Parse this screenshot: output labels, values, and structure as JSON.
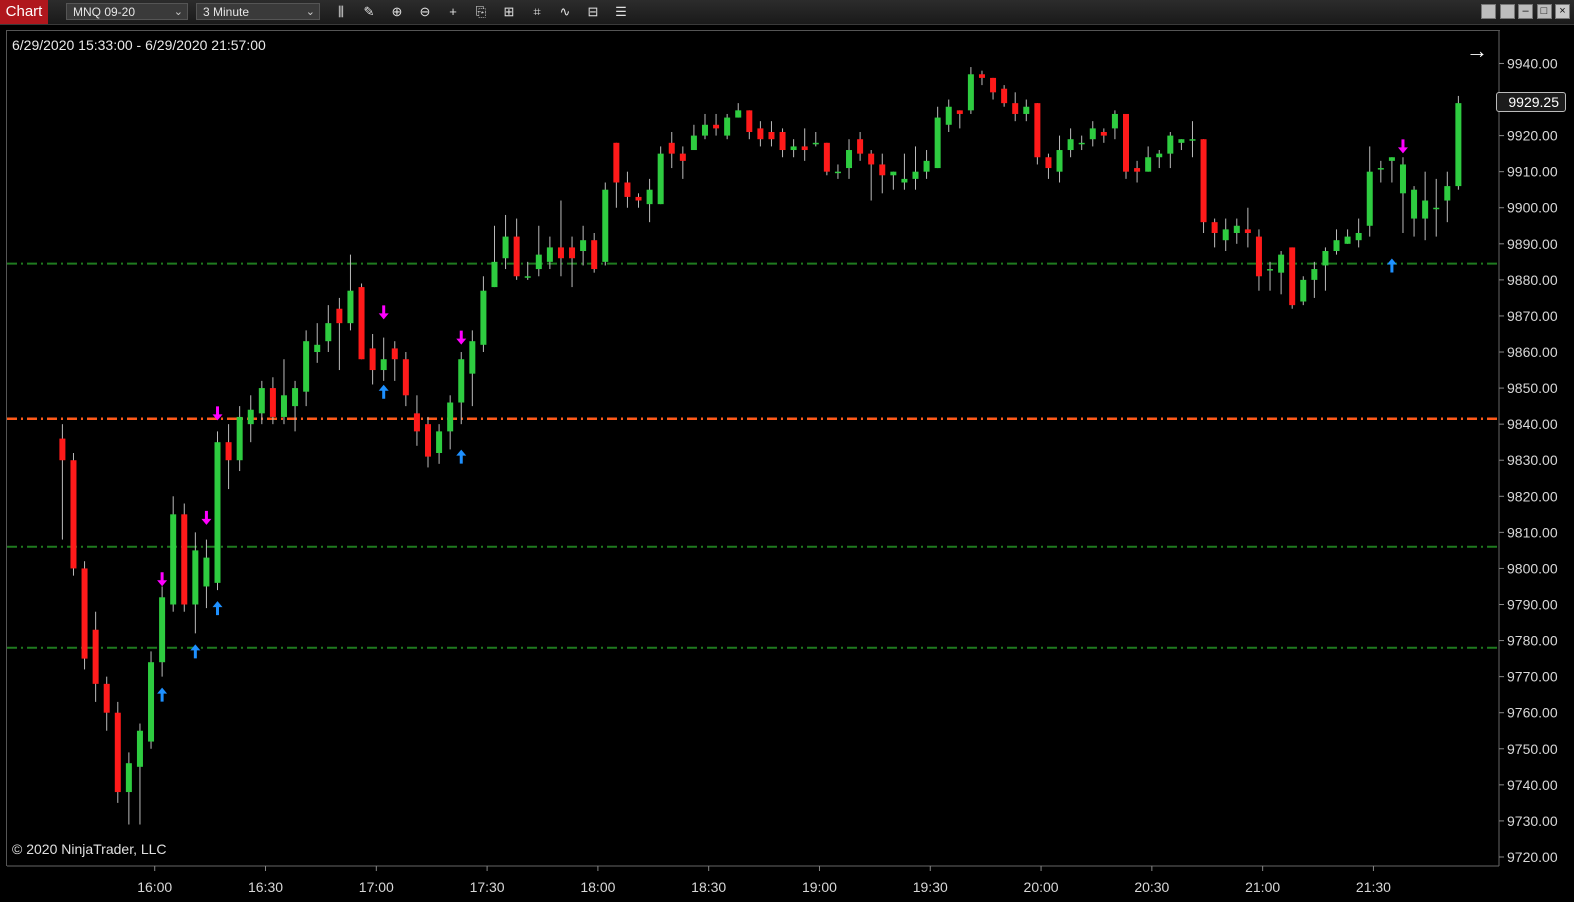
{
  "toolbar": {
    "tab_label": "Chart",
    "instrument": "MNQ 09-20",
    "interval": "3 Minute",
    "tools": [
      {
        "name": "bars-type-icon",
        "glyph": "⫼"
      },
      {
        "name": "drawing-tool-icon",
        "glyph": "✎"
      },
      {
        "name": "zoom-in-icon",
        "glyph": "⊕"
      },
      {
        "name": "zoom-out-icon",
        "glyph": "⊖"
      },
      {
        "name": "crosshair-icon",
        "glyph": "+"
      },
      {
        "name": "templates-icon",
        "glyph": "⎘"
      },
      {
        "name": "properties-icon",
        "glyph": "⊞"
      },
      {
        "name": "indicators-icon",
        "glyph": "⌗"
      },
      {
        "name": "strategies-icon",
        "glyph": "∿"
      },
      {
        "name": "chart-trader-icon",
        "glyph": "⊟"
      },
      {
        "name": "data-box-icon",
        "glyph": "☰"
      }
    ],
    "window_buttons": [
      {
        "name": "window-option-1-button",
        "glyph": ""
      },
      {
        "name": "window-option-2-button",
        "glyph": ""
      },
      {
        "name": "minimize-button",
        "glyph": "–"
      },
      {
        "name": "maximize-button",
        "glyph": "□"
      },
      {
        "name": "close-button",
        "glyph": "×"
      }
    ]
  },
  "chart": {
    "date_range": "6/29/2020 15:33:00 - 6/29/2020 21:57:00",
    "copyright": "© 2020 NinjaTrader, LLC",
    "nav_arrow": "→",
    "last_price": "9929.25"
  },
  "chart_data": {
    "type": "candlestick",
    "y_ticks": [
      "9940.00",
      "9930.00",
      "9920.00",
      "9910.00",
      "9900.00",
      "9890.00",
      "9880.00",
      "9870.00",
      "9860.00",
      "9850.00",
      "9840.00",
      "9830.00",
      "9820.00",
      "9810.00",
      "9800.00",
      "9790.00",
      "9780.00",
      "9770.00",
      "9760.00",
      "9750.00",
      "9740.00",
      "9730.00",
      "9720.00"
    ],
    "y_tick_values": [
      9940,
      9930,
      9920,
      9910,
      9900,
      9890,
      9880,
      9870,
      9860,
      9850,
      9840,
      9830,
      9820,
      9810,
      9800,
      9790,
      9780,
      9770,
      9760,
      9750,
      9740,
      9730,
      9720
    ],
    "x_ticks": [
      "16:00",
      "16:30",
      "17:00",
      "17:30",
      "18:00",
      "18:30",
      "19:00",
      "19:30",
      "20:00",
      "20:30",
      "21:00",
      "21:30"
    ],
    "x_tick_minutes": [
      960,
      990,
      1020,
      1050,
      1080,
      1110,
      1140,
      1170,
      1200,
      1230,
      1260,
      1290
    ],
    "ylim": [
      9717.5,
      9949
    ],
    "time_range": [
      920,
      1324
    ],
    "colors": {
      "up": "#2ecc40",
      "down": "#ff1a1a",
      "wick": "#bbbbbb",
      "level_green": "#1f7a1f",
      "level_orange": "#ff5a1a",
      "arrow_up": "#1e90ff",
      "arrow_down": "#ff00ff"
    },
    "levels": [
      {
        "price": 9884.5,
        "color": "#1f7a1f"
      },
      {
        "price": 9841.5,
        "color": "#ff5a1a"
      },
      {
        "price": 9806.0,
        "color": "#1f7a1f"
      },
      {
        "price": 9778.0,
        "color": "#1f7a1f"
      }
    ],
    "candles": [
      [
        9836,
        9830,
        9840,
        9808
      ],
      [
        9830,
        9800,
        9832,
        9798
      ],
      [
        9800,
        9775,
        9802,
        9772
      ],
      [
        9783,
        9768,
        9788,
        9763
      ],
      [
        9768,
        9760,
        9770,
        9755
      ],
      [
        9760,
        9738,
        9763,
        9735
      ],
      [
        9738,
        9746,
        9749,
        9729
      ],
      [
        9745,
        9755,
        9757,
        9729
      ],
      [
        9752,
        9774,
        9777,
        9750
      ],
      [
        9774,
        9792,
        9795,
        9770
      ],
      [
        9790,
        9815,
        9820,
        9788
      ],
      [
        9815,
        9790,
        9818,
        9788
      ],
      [
        9790,
        9805,
        9810,
        9782
      ],
      [
        9795,
        9803,
        9808,
        9789
      ],
      [
        9796,
        9835,
        9838,
        9794
      ],
      [
        9835,
        9830,
        9840,
        9822
      ],
      [
        9830,
        9842,
        9845,
        9827
      ],
      [
        9840,
        9844,
        9848,
        9835
      ],
      [
        9843,
        9850,
        9852,
        9840
      ],
      [
        9850,
        9842,
        9853,
        9840
      ],
      [
        9842,
        9848,
        9858,
        9840
      ],
      [
        9845,
        9850,
        9852,
        9838
      ],
      [
        9849,
        9863,
        9866,
        9845
      ],
      [
        9860,
        9862,
        9868,
        9857
      ],
      [
        9863,
        9868,
        9873,
        9860
      ],
      [
        9872,
        9868,
        9875,
        9855
      ],
      [
        9868,
        9877,
        9887,
        9866
      ],
      [
        9878,
        9858,
        9879,
        9858
      ],
      [
        9861,
        9855,
        9865,
        9851
      ],
      [
        9855,
        9858,
        9864,
        9852
      ],
      [
        9861,
        9858,
        9863,
        9852
      ],
      [
        9858,
        9848,
        9860,
        9845
      ],
      [
        9843,
        9838,
        9848,
        9834
      ],
      [
        9840,
        9831,
        9842,
        9828
      ],
      [
        9832,
        9838,
        9840,
        9829
      ],
      [
        9838,
        9846,
        9848,
        9833
      ],
      [
        9846,
        9858,
        9860,
        9840
      ],
      [
        9854,
        9863,
        9866,
        9845
      ],
      [
        9862,
        9877,
        9881,
        9860
      ],
      [
        9878,
        9885,
        9895,
        9878
      ],
      [
        9886,
        9892,
        9898,
        9883
      ],
      [
        9892,
        9881,
        9897,
        9880
      ],
      [
        9881,
        9881,
        9885,
        9880
      ],
      [
        9883,
        9887,
        9895,
        9881
      ],
      [
        9885,
        9889,
        9892,
        9883
      ],
      [
        9889,
        9886,
        9902,
        9881
      ],
      [
        9889,
        9886,
        9892,
        9878
      ],
      [
        9888,
        9891,
        9895,
        9884
      ],
      [
        9891,
        9883,
        9893,
        9882
      ],
      [
        9885,
        9905,
        9907,
        9884
      ],
      [
        9918,
        9907,
        9918,
        9900
      ],
      [
        9907,
        9903,
        9910,
        9900
      ],
      [
        9903,
        9902,
        9904,
        9900
      ],
      [
        9901,
        9905,
        9908,
        9896
      ],
      [
        9901,
        9915,
        9917,
        9901
      ],
      [
        9918,
        9915,
        9921,
        9911
      ],
      [
        9915,
        9913,
        9917,
        9908
      ],
      [
        9916,
        9920,
        9923,
        9917
      ],
      [
        9920,
        9923,
        9926,
        9919
      ],
      [
        9923,
        9922,
        9926,
        9920
      ],
      [
        9920,
        9925,
        9926,
        9919
      ],
      [
        9925,
        9927,
        9929,
        9925
      ],
      [
        9927,
        9921,
        9927,
        9919
      ],
      [
        9922,
        9919,
        9924,
        9917
      ],
      [
        9921,
        9919,
        9924,
        9917
      ],
      [
        9921,
        9916,
        9922,
        9914
      ],
      [
        9916,
        9917,
        9919,
        9914
      ],
      [
        9917,
        9916,
        9922,
        9913
      ],
      [
        9918,
        9918,
        9921,
        9917
      ],
      [
        9918,
        9910,
        9918,
        9909
      ],
      [
        9910,
        9910,
        9912,
        9908
      ],
      [
        9911,
        9916,
        9919,
        9908
      ],
      [
        9919,
        9915,
        9921,
        9913
      ],
      [
        9915,
        9912,
        9916,
        9902
      ],
      [
        9912,
        9909,
        9915,
        9904
      ],
      [
        9909,
        9910,
        9910,
        9905
      ],
      [
        9907,
        9908,
        9915,
        9905
      ],
      [
        9908,
        9910,
        9917,
        9905
      ],
      [
        9910,
        9913,
        9916,
        9908
      ],
      [
        9911,
        9925,
        9928,
        9911
      ],
      [
        9923,
        9928,
        9930,
        9921
      ],
      [
        9927,
        9926,
        9927,
        9922
      ],
      [
        9927,
        9937,
        9939,
        9926
      ],
      [
        9937,
        9936,
        9938,
        9934
      ],
      [
        9936,
        9932,
        9936,
        9930
      ],
      [
        9933,
        9929,
        9934,
        9928
      ],
      [
        9929,
        9926,
        9932,
        9924
      ],
      [
        9926,
        9928,
        9930,
        9924
      ],
      [
        9929,
        9914,
        9929,
        9912
      ],
      [
        9914,
        9911,
        9915,
        9908
      ],
      [
        9910,
        9916,
        9920,
        9907
      ],
      [
        9916,
        9919,
        9922,
        9914
      ],
      [
        9918,
        9918,
        9920,
        9916
      ],
      [
        9919,
        9922,
        9924,
        9917
      ],
      [
        9921,
        9920,
        9922,
        9918
      ],
      [
        9922,
        9926,
        9927,
        9919
      ],
      [
        9926,
        9910,
        9926,
        9908
      ],
      [
        9911,
        9910,
        9913,
        9907
      ],
      [
        9910,
        9914,
        9917,
        9910
      ],
      [
        9914,
        9915,
        9916,
        9911
      ],
      [
        9915,
        9920,
        9921,
        9911
      ],
      [
        9918,
        9919,
        9919,
        9916
      ],
      [
        9919,
        9919,
        9924,
        9914
      ],
      [
        9919,
        9896,
        9919,
        9893
      ],
      [
        9896,
        9893,
        9897,
        9889
      ],
      [
        9891,
        9894,
        9897,
        9888
      ],
      [
        9893,
        9895,
        9897,
        9890
      ],
      [
        9894,
        9893,
        9900,
        9889
      ],
      [
        9892,
        9881,
        9894,
        9877
      ],
      [
        9883,
        9883,
        9885,
        9877
      ],
      [
        9882,
        9887,
        9888,
        9876
      ],
      [
        9889,
        9873,
        9889,
        9872
      ],
      [
        9874,
        9880,
        9881,
        9873
      ],
      [
        9880,
        9883,
        9885,
        9875
      ],
      [
        9884,
        9888,
        9889,
        9877
      ],
      [
        9888,
        9891,
        9894,
        9887
      ],
      [
        9890,
        9892,
        9894,
        9890
      ],
      [
        9891,
        9893,
        9897,
        9889
      ],
      [
        9895,
        9910,
        9917,
        9892
      ],
      [
        9911,
        9911,
        9913,
        9907
      ],
      [
        9913,
        9914,
        9914,
        9907
      ],
      [
        9904,
        9912,
        9914,
        9893
      ],
      [
        9897,
        9905,
        9906,
        9892
      ],
      [
        9897,
        9902,
        9910,
        9891
      ],
      [
        9900,
        9900,
        9908,
        9892
      ],
      [
        9902,
        9906,
        9910,
        9896
      ],
      [
        9906,
        9929,
        9931,
        9905
      ]
    ],
    "signals": [
      {
        "idx": 9,
        "dir": "down",
        "price": 9797
      },
      {
        "idx": 9,
        "dir": "up",
        "price": 9765
      },
      {
        "idx": 12,
        "dir": "up",
        "price": 9777
      },
      {
        "idx": 13,
        "dir": "down",
        "price": 9814
      },
      {
        "idx": 14,
        "dir": "down",
        "price": 9843
      },
      {
        "idx": 14,
        "dir": "up",
        "price": 9789
      },
      {
        "idx": 29,
        "dir": "down",
        "price": 9871
      },
      {
        "idx": 29,
        "dir": "up",
        "price": 9849
      },
      {
        "idx": 36,
        "dir": "down",
        "price": 9864
      },
      {
        "idx": 36,
        "dir": "up",
        "price": 9831
      },
      {
        "idx": 121,
        "dir": "down",
        "price": 9917
      },
      {
        "idx": 120,
        "dir": "up",
        "price": 9884
      }
    ]
  }
}
